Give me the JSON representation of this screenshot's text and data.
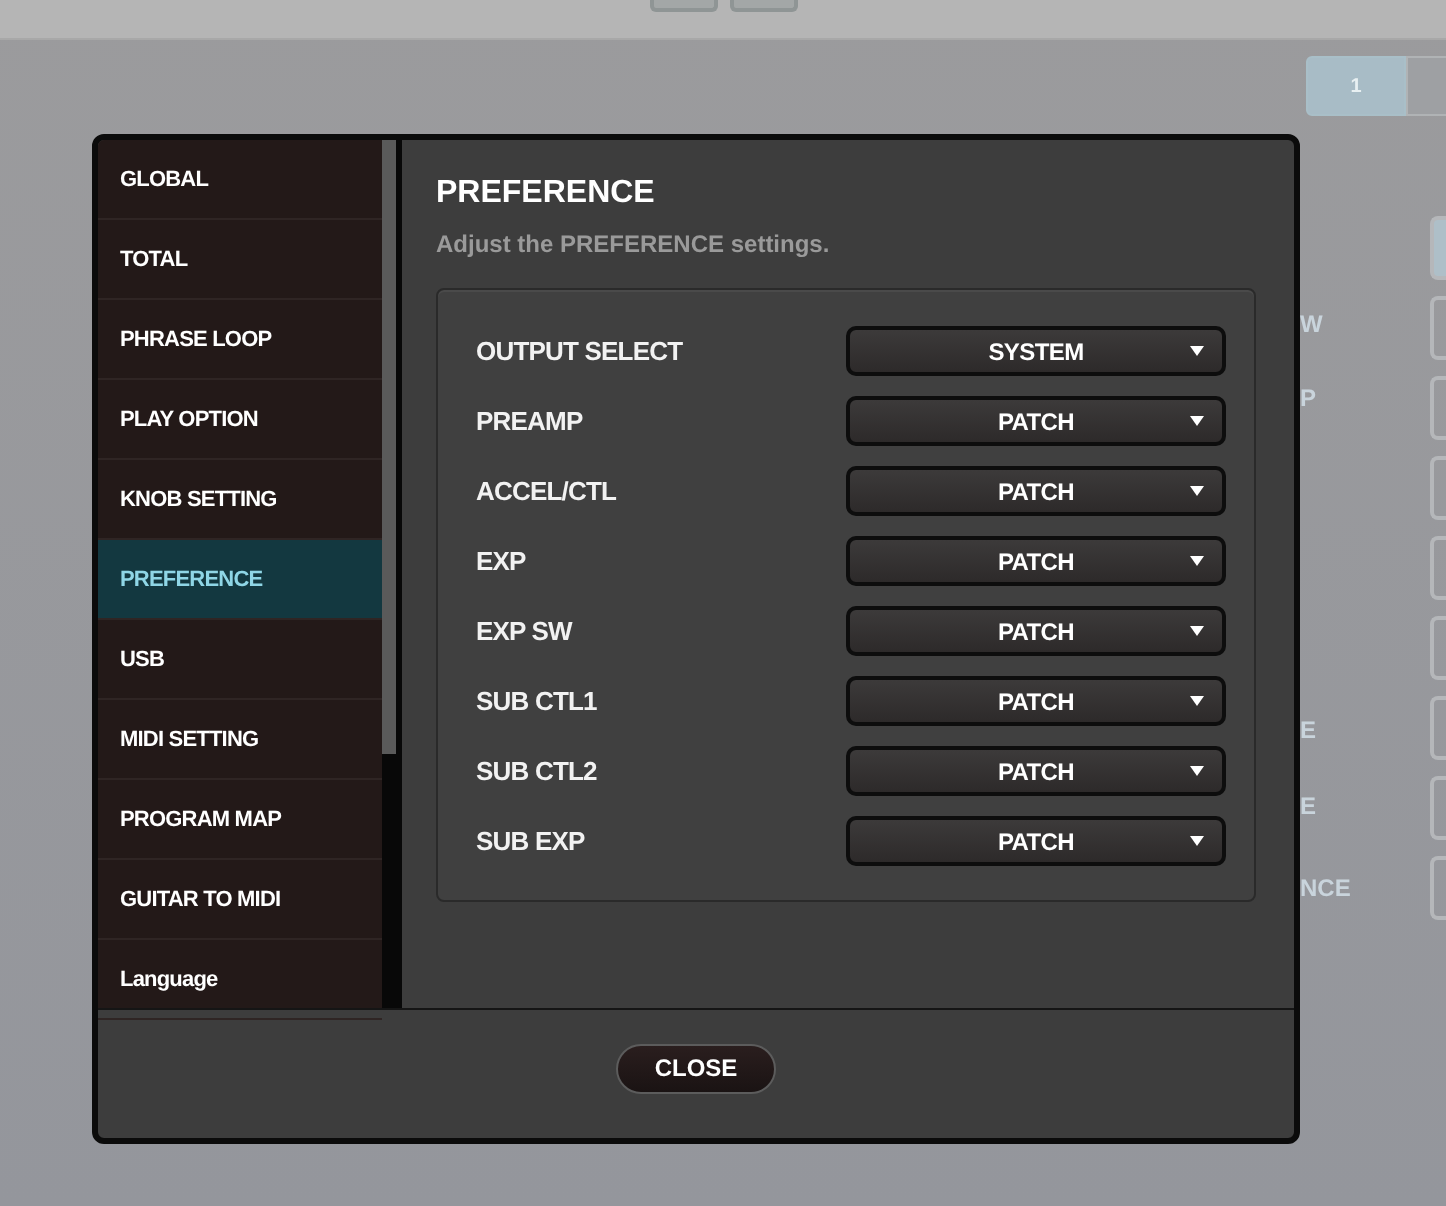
{
  "background": {
    "page_tab": "1",
    "labels": [
      "W",
      "P",
      "E",
      "E",
      "NCE"
    ]
  },
  "dialog": {
    "sidebar": [
      {
        "label": "GLOBAL",
        "selected": false
      },
      {
        "label": "TOTAL",
        "selected": false
      },
      {
        "label": "PHRASE LOOP",
        "selected": false
      },
      {
        "label": "PLAY OPTION",
        "selected": false
      },
      {
        "label": "KNOB SETTING",
        "selected": false
      },
      {
        "label": "PREFERENCE",
        "selected": true
      },
      {
        "label": "USB",
        "selected": false
      },
      {
        "label": "MIDI SETTING",
        "selected": false
      },
      {
        "label": "PROGRAM MAP",
        "selected": false
      },
      {
        "label": "GUITAR TO MIDI",
        "selected": false
      },
      {
        "label": "Language",
        "selected": false
      }
    ],
    "title": "PREFERENCE",
    "subtitle": "Adjust the PREFERENCE settings.",
    "settings": [
      {
        "label": "OUTPUT SELECT",
        "value": "SYSTEM"
      },
      {
        "label": "PREAMP",
        "value": "PATCH"
      },
      {
        "label": "ACCEL/CTL",
        "value": "PATCH"
      },
      {
        "label": "EXP",
        "value": "PATCH"
      },
      {
        "label": "EXP SW",
        "value": "PATCH"
      },
      {
        "label": "SUB CTL1",
        "value": "PATCH"
      },
      {
        "label": "SUB CTL2",
        "value": "PATCH"
      },
      {
        "label": "SUB EXP",
        "value": "PATCH"
      }
    ],
    "close_button": "CLOSE"
  }
}
